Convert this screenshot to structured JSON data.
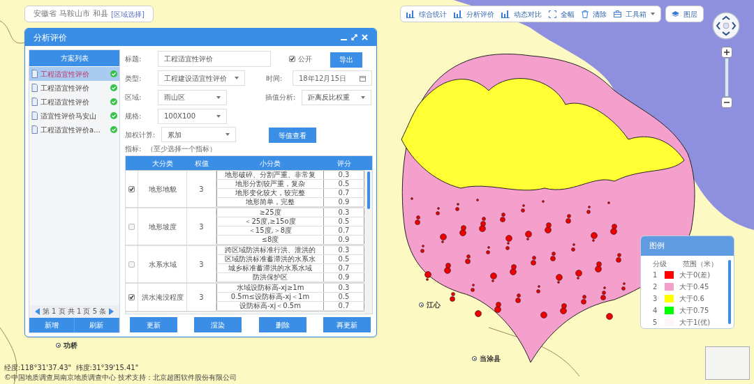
{
  "breadcrumb": {
    "items": [
      "安徽省",
      "马鞍山市",
      "和县"
    ],
    "action": "[区域选择]"
  },
  "toolbar": {
    "items": [
      {
        "label": "综合统计",
        "kind": "chart"
      },
      {
        "label": "分析评价",
        "kind": "chart"
      },
      {
        "label": "动态对比",
        "kind": "chart"
      },
      {
        "label": "全幅",
        "kind": "extent"
      },
      {
        "label": "清除",
        "kind": "clear"
      },
      {
        "label": "工具箱",
        "kind": "toolbox"
      }
    ],
    "layers": "图层"
  },
  "dialog": {
    "title": "分析评价",
    "plan_list": {
      "title": "方案列表",
      "items": [
        {
          "label": "工程适宜性评价",
          "selected": true
        },
        {
          "label": "工程适宜性评价",
          "selected": false
        },
        {
          "label": "工程适宜性评价",
          "selected": false
        },
        {
          "label": "适宜性评价马安山",
          "selected": false
        },
        {
          "label": "工程适宜性评价a...",
          "selected": false
        }
      ],
      "pager": "第 1 页 共 1 页 5 条",
      "buttons": [
        "新增",
        "刷新"
      ]
    },
    "form": {
      "title_label": "标题:",
      "title_value": "工程适宜性评价",
      "public": {
        "label": "公开",
        "checked": true
      },
      "export": "导出",
      "type": {
        "label": "类型:",
        "value": "工程建设适宜性评价"
      },
      "time": {
        "label": "时间:",
        "value": "18年12月15日"
      },
      "region": {
        "label": "区域:",
        "value": "雨山区"
      },
      "interp": {
        "label": "插值分析:",
        "value": "距离反比权重"
      },
      "spec": {
        "label": "规格:",
        "value": "100X100"
      },
      "weight": {
        "label": "加权计算:",
        "value": "累加"
      },
      "view_button": "等值查看",
      "indicator_label": "指标:",
      "indicator_hint": "（至少选择一个指标）"
    },
    "table": {
      "columns": [
        "大分类",
        "权值",
        "小分类",
        "评分"
      ],
      "rows": [
        {
          "checked": true,
          "category": "地形地貌",
          "weight": "3",
          "subs": [
            {
              "name": "地形破碎、分割严重、非常复",
              "score": "0.3"
            },
            {
              "name": "地形分割较严重，复杂",
              "score": "0.5"
            },
            {
              "name": "地形变化较大，较完整",
              "score": "0.7"
            },
            {
              "name": "地形简单，完整",
              "score": "0.9"
            }
          ]
        },
        {
          "checked": false,
          "category": "地形坡度",
          "weight": "3",
          "subs": [
            {
              "name": "≥25度",
              "score": "0.3"
            },
            {
              "name": "＜25度,≥15o度",
              "score": "0.5"
            },
            {
              "name": "＜15度,＞8度",
              "score": "0.7"
            },
            {
              "name": "≤8度",
              "score": "0.9"
            }
          ]
        },
        {
          "checked": false,
          "category": "水系水域",
          "weight": "3",
          "subs": [
            {
              "name": "跨区域防洪标准行洪、泄洪的",
              "score": "0.3"
            },
            {
              "name": "区域防洪标准蓄滞洪的水系水",
              "score": "0.5"
            },
            {
              "name": "城乡标准蓄滞洪的水系水域",
              "score": "0.7"
            },
            {
              "name": "防洪保护区",
              "score": "0.9"
            }
          ]
        },
        {
          "checked": true,
          "category": "洪水淹没程度",
          "weight": "3",
          "subs": [
            {
              "name": "水域设防标高-xj≥1m",
              "score": "0.3"
            },
            {
              "name": "0.5m≤设防标高-xj＜1m",
              "score": "0.5"
            },
            {
              "name": "设防标高-xj＜0.5m",
              "score": "0.7"
            }
          ]
        }
      ]
    },
    "buttons": [
      "更新",
      "渲染",
      "删除",
      "再更新"
    ]
  },
  "map_labels": [
    {
      "text": "功桥"
    },
    {
      "text": "江心"
    },
    {
      "text": "当涂县"
    }
  ],
  "legend": {
    "title": "图例",
    "columns": [
      "分级",
      "范围（米）"
    ],
    "items": [
      {
        "grade": "1",
        "range": "大于0(差)",
        "color": "#ff0000"
      },
      {
        "grade": "2",
        "range": "大于0.45",
        "color": "#f5a0cc"
      },
      {
        "grade": "3",
        "range": "大于0.6",
        "color": "#ffff00"
      },
      {
        "grade": "4",
        "range": "大于0.75",
        "color": "#00ff00"
      },
      {
        "grade": "5",
        "range": "大于1(优)",
        "color": "#fdf5f8"
      }
    ]
  },
  "status": {
    "coords": "经度:118°31'37.43\"  纬度:31°39'15.41\"",
    "copyright": "©中国地质调查局南京地质调查中心 技术支持：北京超图软件股份有限公司"
  }
}
